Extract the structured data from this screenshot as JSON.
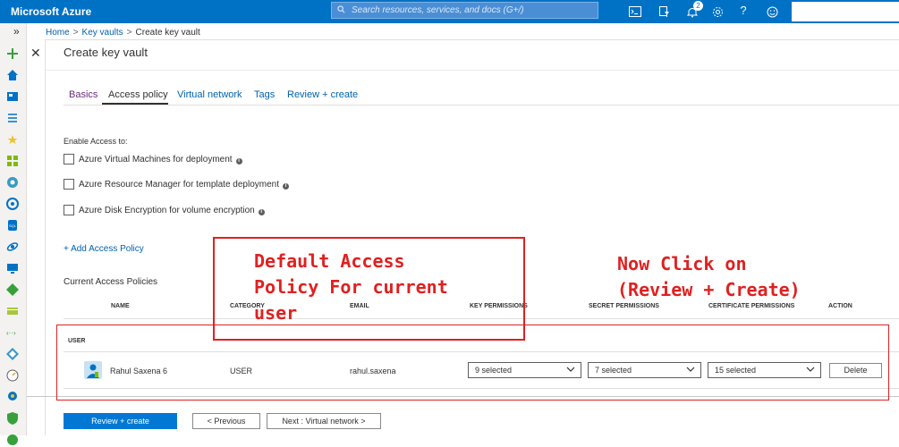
{
  "header": {
    "brand": "Microsoft Azure",
    "search_placeholder": "Search resources, services, and docs (G+/)",
    "notification_count": "2"
  },
  "breadcrumb": {
    "items": [
      "Home",
      "Key vaults",
      "Create key vault"
    ]
  },
  "page": {
    "title": "Create key vault"
  },
  "tabs": [
    {
      "label": "Basics",
      "state": "visited"
    },
    {
      "label": "Access policy",
      "state": "active"
    },
    {
      "label": "Virtual network",
      "state": "normal"
    },
    {
      "label": "Tags",
      "state": "normal"
    },
    {
      "label": "Review + create",
      "state": "normal"
    }
  ],
  "enable_access": {
    "heading": "Enable Access to:",
    "options": [
      {
        "label": "Azure Virtual Machines for deployment",
        "checked": false
      },
      {
        "label": "Azure Resource Manager for template deployment",
        "checked": false
      },
      {
        "label": "Azure Disk Encryption for volume encryption",
        "checked": false
      }
    ]
  },
  "add_policy_label": "+ Add Access Policy",
  "policies": {
    "heading": "Current Access Policies",
    "columns": [
      "NAME",
      "CATEGORY",
      "EMAIL",
      "KEY PERMISSIONS",
      "SECRET PERMISSIONS",
      "CERTIFICATE PERMISSIONS",
      "ACTION"
    ],
    "group_label": "USER",
    "rows": [
      {
        "name": "Rahul Saxena 6",
        "category": "USER",
        "email": "rahul.saxena",
        "key_permissions": "9 selected",
        "secret_permissions": "7 selected",
        "certificate_permissions": "15 selected",
        "action": "Delete"
      }
    ]
  },
  "footer": {
    "primary": "Review + create",
    "previous": "< Previous",
    "next": "Next : Virtual network >"
  },
  "annotations": {
    "default_policy": "Default Access\nPolicy For current\nuser",
    "instruction": "Now Click on\n(Review + Create)",
    "color": "#e02020"
  },
  "colors": {
    "header": "#0072c6",
    "link": "#0062ad",
    "primary_button": "#0078d4"
  }
}
